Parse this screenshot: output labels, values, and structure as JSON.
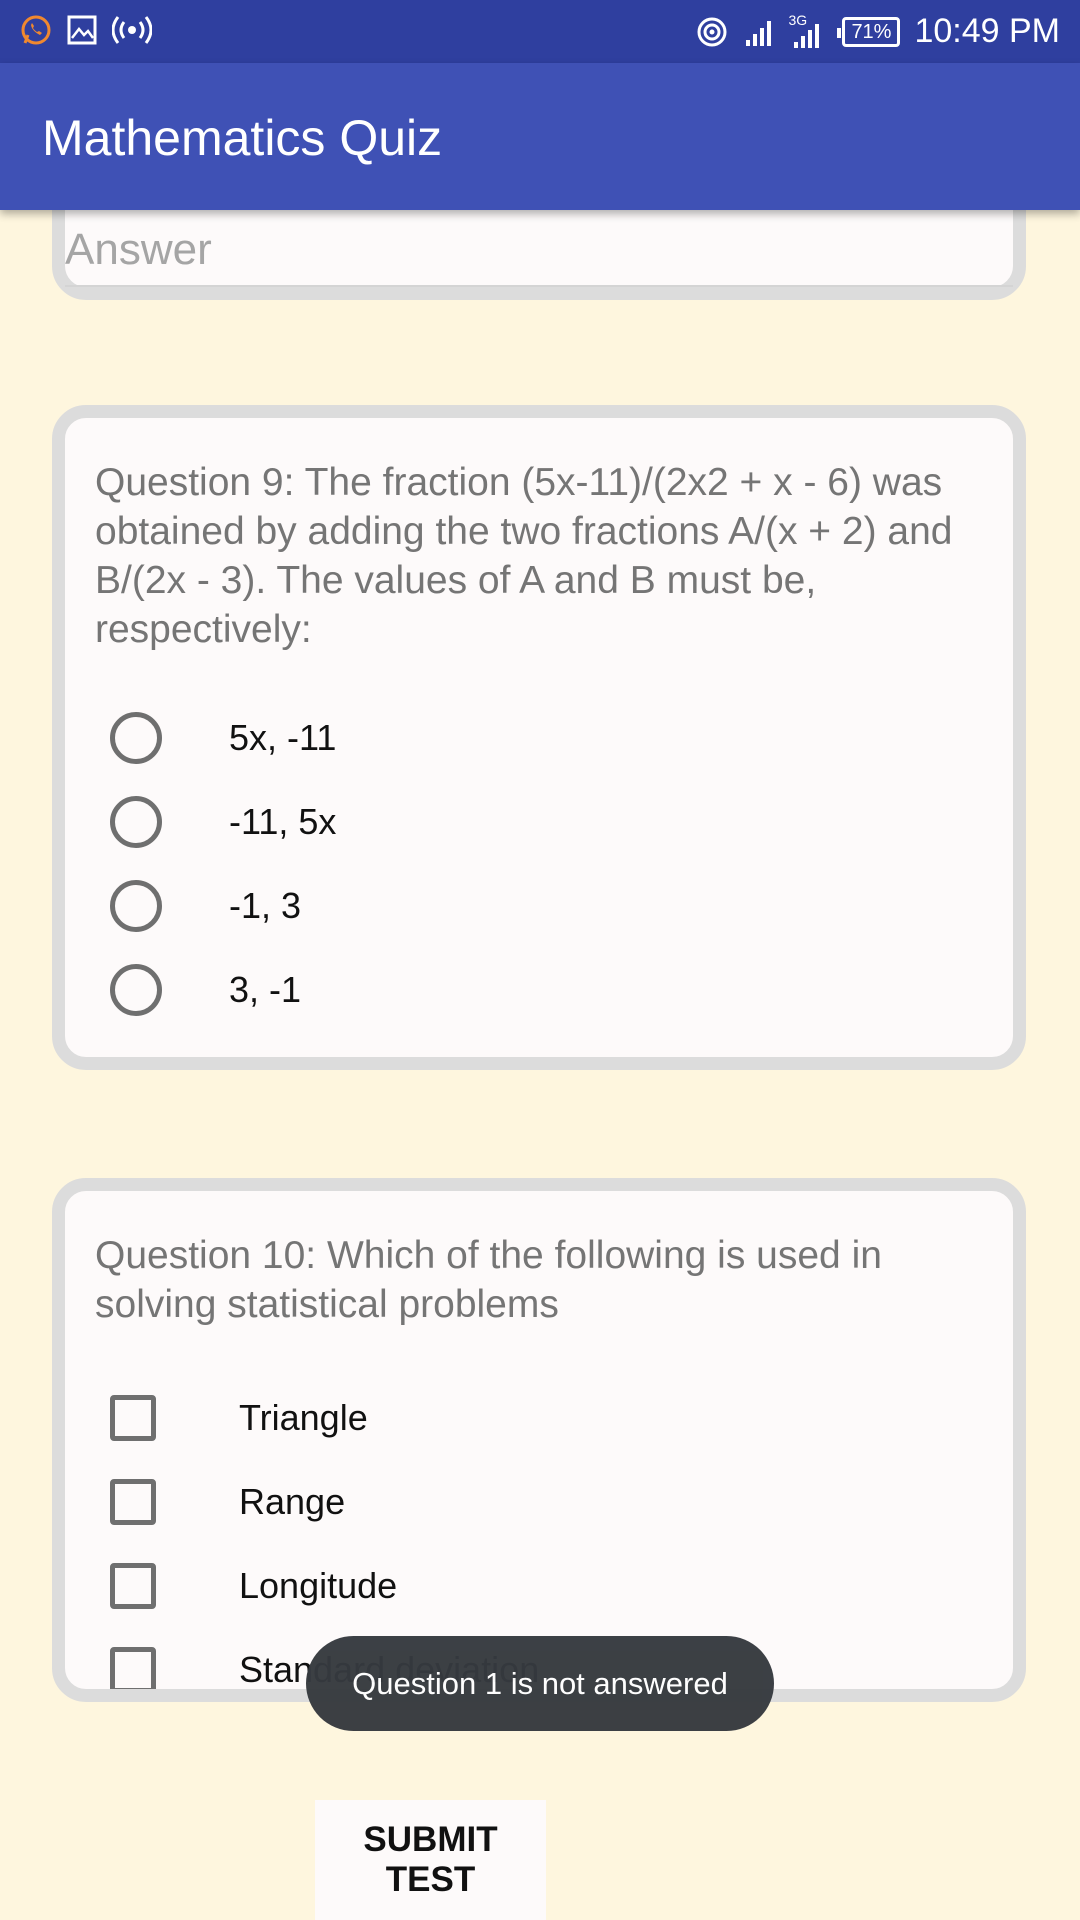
{
  "status_bar": {
    "time": "10:49 PM",
    "battery": "71%",
    "network": "3G",
    "colors": {
      "bar": "#2f3f9f"
    }
  },
  "app_bar": {
    "title": "Mathematics Quiz",
    "color": "#3f51b5"
  },
  "answer_field": {
    "placeholder": "Answer"
  },
  "question9": {
    "text": "Question 9: The fraction (5x-11)/(2x2 + x - 6) was obtained by adding the two fractions A/(x + 2) and B/(2x - 3). The values of A and B must be, respectively:",
    "options": [
      "5x, -11",
      "-11, 5x",
      "-1, 3",
      "3, -1"
    ]
  },
  "question10": {
    "text": "Question 10: Which of the following is used in solving statistical problems",
    "options": [
      "Triangle",
      "Range",
      "Longitude",
      "Standard deviation"
    ]
  },
  "toast": {
    "message": "Question 1 is not answered"
  },
  "submit": {
    "label": "SUBMIT TEST"
  },
  "colors": {
    "background": "#fef6de",
    "card": "#fdfafa",
    "card_border": "#dcdcdc"
  }
}
